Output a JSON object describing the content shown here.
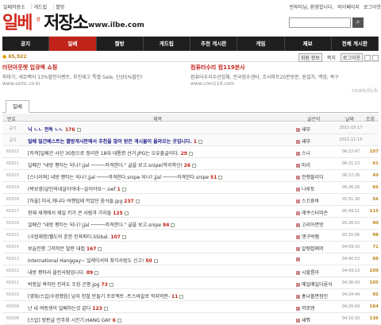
{
  "topbar": {
    "site": "일베저장소",
    "menu1": "게드립",
    "menu2": "짤방",
    "greeting": "반투타님, 환영합니다.",
    "mypage": "마이페이지",
    "logout": "로그아웃"
  },
  "logo": {
    "red": "일베",
    "small": "간",
    "black": "저장소",
    "url": "www.ilbe.com"
  },
  "nav": {
    "items": [
      "공지",
      "일베",
      "짤방",
      "게드립",
      "추천 게시판",
      "게임",
      "제보",
      "전체 게시판"
    ]
  },
  "sub": {
    "points": "65,922",
    "links": [
      "회원 정보",
      "쪽지",
      "로그아웃"
    ]
  },
  "ads": [
    {
      "title": "러던아웃렛 입큐엑 쇼핑",
      "desc": "파마가, 세뮤팩이 13%할인이벤트, 부진재고 특별 Sale, 신상5%할인!",
      "url": "www.ssmc.co.kr"
    },
    {
      "title": "컴퓨터수리 컴119본사",
      "desc": "컴퓨터수리수선업체, 전국컴수센터, 조사파트20분방문, 원설치, 백업, 복구",
      "url": "www.com119.com"
    }
  ],
  "brand_note": "realclick",
  "tab": "일베",
  "thead": {
    "num": "번호",
    "title": "제목",
    "author": "글쓴이",
    "date": "날짜",
    "views": "조회"
  },
  "rows": [
    {
      "num": "공지",
      "title": "닉 ㄴㄴ 전독 ㄴㄴ",
      "comments": "176",
      "author": "새부",
      "date": "2011-10-17",
      "views": "",
      "notice": true
    },
    {
      "num": "공지",
      "title": "일베 일간베스트는 짤방게시판에서 추천을 많이 받은 게시물이 올라오는 곳입니다.",
      "comments": "1",
      "author": "새부",
      "date": "2011-11-15",
      "views": "",
      "notice": true
    },
    {
      "num": "65922",
      "title": "[저격]일베간 사진 30장으로 정리한 18대 대통령 선거.JPG는 오유출글이다.",
      "comments": "29",
      "author": "스나",
      "date": "06:22:47",
      "views": "107",
      "notice": false
    },
    {
      "num": "65921",
      "title": "일베간 \"내방 평타는 되나?.jjal ─────저격한다.\" 글을 보고.snipe(학과학신)",
      "comments": "26",
      "author": "마리",
      "date": "06:21:13",
      "views": "61",
      "notice": false
    },
    {
      "num": "65920",
      "title": "[스나이퍼] 내방 평타는 되나?.jjal ────저격한다.snipe 되나?.jjal ─────저격한다.snipe",
      "comments": "51",
      "author": "전쟁블리디",
      "date": "06:27:26",
      "views": "49",
      "notice": false
    },
    {
      "num": "65919",
      "title": "(박보영)살인의네살이야네ㅡ살이야요ㅡ.swf",
      "comments": "1",
      "author": "나루토",
      "date": "06:26:26",
      "views": "66",
      "notice": false
    },
    {
      "num": "65918",
      "title": "[하울] 미국,캐나다 여행팁때 먹었던 음식들.jpg",
      "comments": "237",
      "author": "스끄휴바",
      "date": "05:51:30",
      "views": "56",
      "notice": false
    },
    {
      "num": "65917",
      "title": "현재 세계에서 제일 키가 큰 사람과 가자들",
      "comments": "125",
      "author": "레쿠스터미손",
      "date": "05:49:11",
      "views": "115",
      "notice": false
    },
    {
      "num": "65916",
      "title": "일베간 \"내방 평타는 되나?.jjal ─────저격한다.\" 글을 보고.snipe",
      "comments": "84",
      "author": "고리아면방",
      "date": "05:26:02",
      "views": "90",
      "notice": false
    },
    {
      "num": "65915",
      "title": "(극협재명)웰도의 흔한 인육파티.SSibal.",
      "comments": "107",
      "author": "앵구박램",
      "date": "05:15:06",
      "views": "98",
      "notice": false
    },
    {
      "num": "65914",
      "title": "보슬전쟁 그저작은 발란 대접",
      "comments": "167",
      "author": "알렛첩쩌머",
      "date": "04:59:10",
      "views": "71",
      "notice": false
    },
    {
      "num": "65913",
      "title": "International Hanggay~ 일레이서와 좌익사범도 신고!",
      "comments": "50",
      "author": "",
      "date": "04:40:53",
      "views": "88",
      "notice": false
    },
    {
      "num": "65912",
      "title": "내방 평타라 올린사람입니다.",
      "comments": "89",
      "author": "시할름아",
      "date": "04:43:13",
      "views": "109",
      "notice": false
    },
    {
      "num": "65911",
      "title": "박정실 욕하던 전라도 조징 곤봉.jpg",
      "comments": "73",
      "author": "메일메일다론식",
      "date": "04:36:43",
      "views": "105",
      "notice": false
    },
    {
      "num": "65910",
      "title": "[영화/스압/수정했음] 남자 친철 만들기 프로젝트 -트스바갈로 먹지먹란-",
      "comments": "11",
      "author": "홍냐볼면정인",
      "date": "04:24:44",
      "views": "95",
      "notice": false
    },
    {
      "num": "65909",
      "title": "난 내 여동생이 일베하는것 같다",
      "comments": "123",
      "author": "까로덴",
      "date": "04:20:09",
      "views": "164",
      "notice": false
    },
    {
      "num": "65908",
      "title": "[스압] 벙판글 인주화 시킨기.HANG GAY",
      "comments": "6",
      "author": "새뤄",
      "date": "04:16:10",
      "views": "136",
      "notice": false
    }
  ]
}
